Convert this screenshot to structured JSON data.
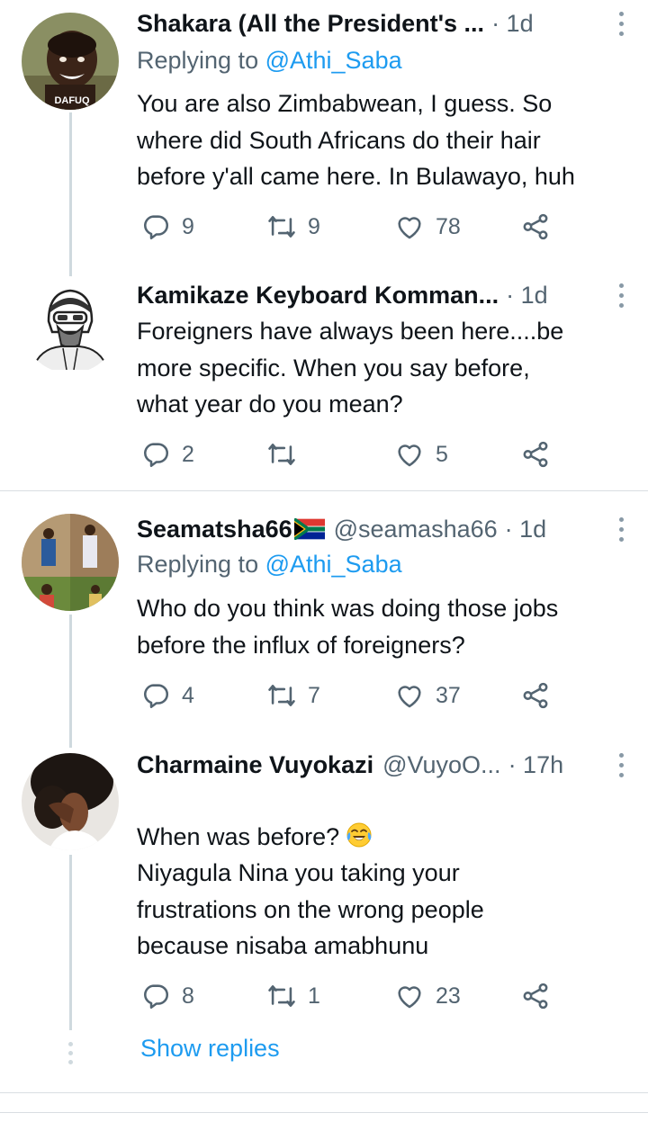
{
  "tweets": [
    {
      "name": "Shakara (All the President's ...",
      "handle": "",
      "time": "· 1d",
      "replying_label": "Replying to ",
      "replying_to": "@Athi_Saba",
      "text": "You are also Zimbabwean,  I guess.  So\nwhere did South Africans do their hair\nbefore y'all came here. In Bulawayo, huh",
      "avatar_caption": "DAFUQ",
      "replies": "9",
      "retweets": "9",
      "likes": "78"
    },
    {
      "name": "Kamikaze Keyboard Komman...",
      "handle": "",
      "time": "· 1d",
      "replying_label": "",
      "replying_to": "",
      "text": "Foreigners have always been here....be\nmore specific. When you say before,\nwhat year do you mean?",
      "replies": "2",
      "retweets": "",
      "likes": "5"
    },
    {
      "name": "Seamatsha66",
      "handle": "@seamasha66",
      "time": "· 1d",
      "replying_label": "Replying to ",
      "replying_to": "@Athi_Saba",
      "text": "Who do you think was doing those jobs\nbefore the influx of foreigners?",
      "replies": "4",
      "retweets": "7",
      "likes": "37"
    },
    {
      "name": "Charmaine Vuyokazi",
      "handle": "@VuyoO...",
      "time": "· 17h",
      "replying_label": "",
      "replying_to": "",
      "text_line1": "When was before?",
      "text": "Niyagula Nina you taking your\nfrustrations on the wrong people\nbecause nisaba amabhunu",
      "replies": "8",
      "retweets": "1",
      "likes": "23"
    }
  ],
  "show_replies": "Show replies",
  "icons": [
    "reply-icon",
    "retweet-icon",
    "like-icon",
    "share-icon",
    "more-icon"
  ],
  "colors": {
    "link": "#1d9bf0",
    "secondary": "#536471",
    "thread_line": "#cfd9de"
  }
}
